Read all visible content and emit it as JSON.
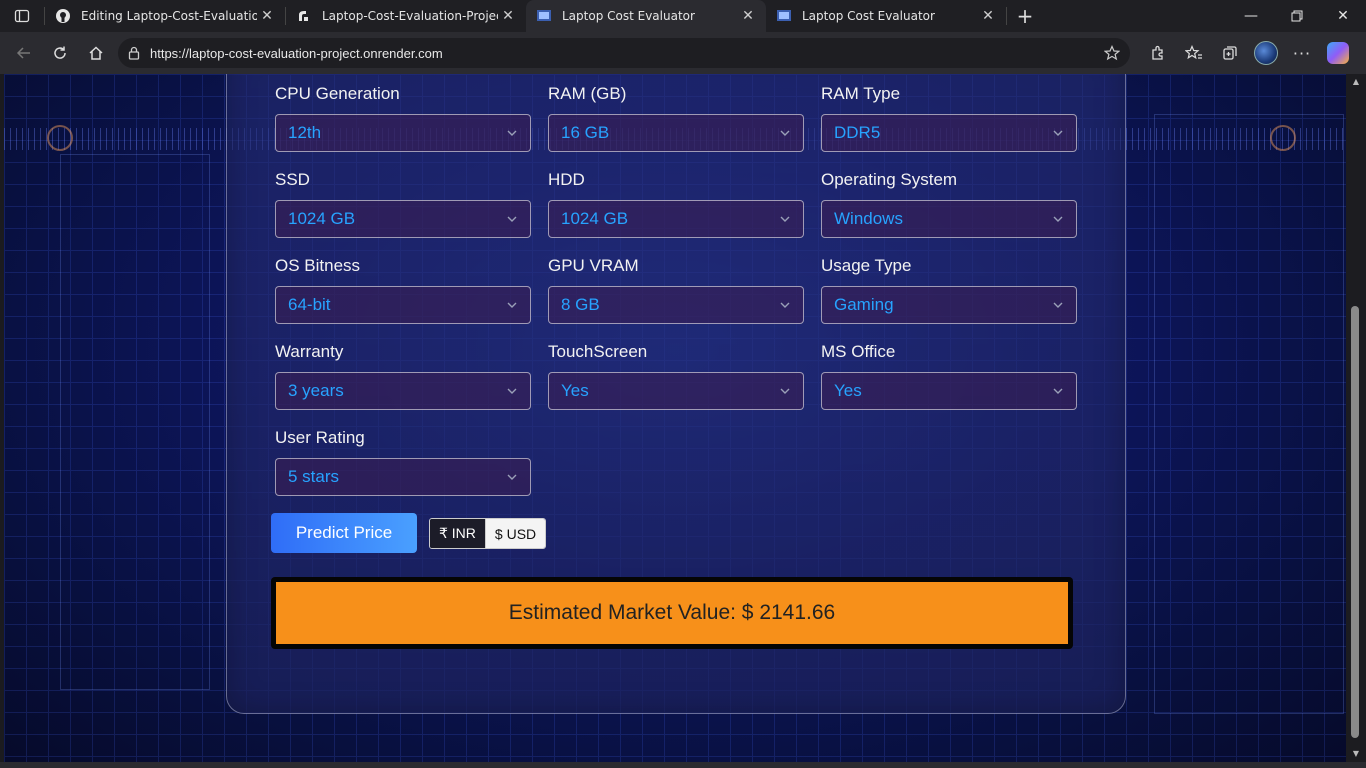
{
  "browser": {
    "tabs": [
      {
        "title": "Editing Laptop-Cost-Evaluation-P",
        "favicon": "github-icon",
        "active": false
      },
      {
        "title": "Laptop-Cost-Evaluation-Project ·",
        "favicon": "render-icon",
        "active": false
      },
      {
        "title": "Laptop Cost Evaluator",
        "favicon": "app-icon",
        "active": true
      },
      {
        "title": "Laptop Cost Evaluator",
        "favicon": "app-icon",
        "active": false
      }
    ],
    "url": "https://laptop-cost-evaluation-project.onrender.com"
  },
  "form": {
    "fields": [
      {
        "label": "CPU Generation",
        "value": "12th"
      },
      {
        "label": "RAM (GB)",
        "value": "16 GB"
      },
      {
        "label": "RAM Type",
        "value": "DDR5"
      },
      {
        "label": "SSD",
        "value": "1024 GB"
      },
      {
        "label": "HDD",
        "value": "1024 GB"
      },
      {
        "label": "Operating System",
        "value": "Windows"
      },
      {
        "label": "OS Bitness",
        "value": "64-bit"
      },
      {
        "label": "GPU VRAM",
        "value": "8 GB"
      },
      {
        "label": "Usage Type",
        "value": "Gaming"
      },
      {
        "label": "Warranty",
        "value": "3 years"
      },
      {
        "label": "TouchScreen",
        "value": "Yes"
      },
      {
        "label": "MS Office",
        "value": "Yes"
      },
      {
        "label": "User Rating",
        "value": "5 stars"
      }
    ],
    "predict_label": "Predict Price",
    "currency": {
      "inr_label": "₹ INR",
      "usd_label": "$ USD",
      "selected": "USD"
    },
    "result_text": "Estimated Market Value: $ 2141.66"
  },
  "colors": {
    "select_value": "#27a3ff",
    "result_bg": "#f7901a",
    "predict_btn": "#2f6df7"
  }
}
